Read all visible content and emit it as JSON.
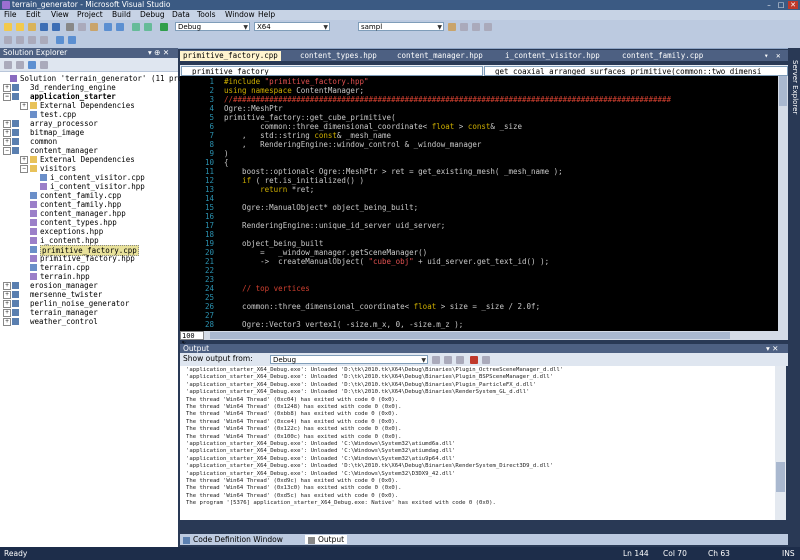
{
  "window": {
    "title": "terrain_generator - Microsoft Visual Studio",
    "min": "–",
    "max": "□",
    "close": "✕"
  },
  "menu": [
    "File",
    "Edit",
    "View",
    "Project",
    "Build",
    "Debug",
    "Data",
    "Tools",
    "Window",
    "Help"
  ],
  "toolbar": {
    "config": "Debug",
    "platform": "X64",
    "find": "sampl"
  },
  "solution_explorer": {
    "title": "Solution Explorer",
    "pin": "▾ ⊕ ✕",
    "items": [
      {
        "label": "Solution 'terrain_generator' (11 proj",
        "icon": "solution-icon"
      },
      {
        "label": "3d_rendering_engine",
        "icon": "project-icon"
      },
      {
        "label": "application_starter",
        "icon": "project-icon"
      },
      {
        "label": "External Dependencies",
        "icon": "folder-icon"
      },
      {
        "label": "test.cpp",
        "icon": "cpp-file-icon"
      },
      {
        "label": "array_processor",
        "icon": "project-icon"
      },
      {
        "label": "bitmap_image",
        "icon": "project-icon"
      },
      {
        "label": "common",
        "icon": "project-icon"
      },
      {
        "label": "content_manager",
        "icon": "project-icon"
      },
      {
        "label": "External Dependencies",
        "icon": "folder-icon"
      },
      {
        "label": "visitors",
        "icon": "folder-icon"
      },
      {
        "label": "i_content_visitor.cpp",
        "icon": "cpp-file-icon"
      },
      {
        "label": "i_content_visitor.hpp",
        "icon": "hpp-file-icon"
      },
      {
        "label": "content_family.cpp",
        "icon": "cpp-file-icon"
      },
      {
        "label": "content_family.hpp",
        "icon": "hpp-file-icon"
      },
      {
        "label": "content_manager.hpp",
        "icon": "hpp-file-icon"
      },
      {
        "label": "content_types.hpp",
        "icon": "hpp-file-icon"
      },
      {
        "label": "exceptions.hpp",
        "icon": "hpp-file-icon"
      },
      {
        "label": "i_content.hpp",
        "icon": "hpp-file-icon"
      },
      {
        "label": "primitive_factory.cpp",
        "icon": "cpp-file-icon"
      },
      {
        "label": "primitive_factory.hpp",
        "icon": "hpp-file-icon"
      },
      {
        "label": "terrain.cpp",
        "icon": "cpp-file-icon"
      },
      {
        "label": "terrain.hpp",
        "icon": "hpp-file-icon"
      },
      {
        "label": "erosion_manager",
        "icon": "project-icon"
      },
      {
        "label": "mersenne_twister",
        "icon": "project-icon"
      },
      {
        "label": "perlin_noise_generator",
        "icon": "project-icon"
      },
      {
        "label": "terrain_manager",
        "icon": "project-icon"
      },
      {
        "label": "weather_control",
        "icon": "project-icon"
      }
    ]
  },
  "tabs": [
    "primitive_factory.cpp",
    "content_types.hpp",
    "content_manager.hpp",
    "i_content_visitor.hpp",
    "content_family.cpp"
  ],
  "navbar": {
    "left": "primitive_factory",
    "right": "get_coaxial_arranged_surfaces_primitive(common::two_dimensi"
  },
  "code_lines": [
    {
      "n": "1",
      "html": "<span class='kw'>#include</span> <span class='st'>\"primitive_factory.hpp\"</span>"
    },
    {
      "n": "2",
      "html": "<span class='kw'>using namespace</span> ContentManager;"
    },
    {
      "n": "3",
      "html": "<span class='cm'>//#################################################################################################</span>"
    },
    {
      "n": "4",
      "html": "Ogre::MeshPtr"
    },
    {
      "n": "5",
      "html": "primitive_factory::get_cube_primitive("
    },
    {
      "n": "6",
      "html": "        common::three_dimensional_coordinate&lt; <span class='kw'>float</span> &gt; <span class='kw'>const</span>&amp; _size"
    },
    {
      "n": "7",
      "html": "    ,   std::string <span class='kw'>const</span>&amp; _mesh_name"
    },
    {
      "n": "8",
      "html": "    ,   RenderingEngine::window_control &amp; _window_manager"
    },
    {
      "n": "9",
      "html": ")"
    },
    {
      "n": "10",
      "html": "{"
    },
    {
      "n": "11",
      "html": "    boost::optional&lt; Ogre::MeshPtr &gt; ret = get_existing_mesh( _mesh_name );"
    },
    {
      "n": "12",
      "html": "    <span class='kw'>if</span> ( ret.is_initialized() )"
    },
    {
      "n": "13",
      "html": "        <span class='kw'>return</span> *ret;"
    },
    {
      "n": "14",
      "html": ""
    },
    {
      "n": "15",
      "html": "    Ogre::ManualObject* object_being_built;"
    },
    {
      "n": "16",
      "html": ""
    },
    {
      "n": "17",
      "html": "    RenderingEngine::unique_id_server uid_server;"
    },
    {
      "n": "18",
      "html": ""
    },
    {
      "n": "19",
      "html": "    object_being_built"
    },
    {
      "n": "20",
      "html": "        =   _window_manager.getSceneManager()"
    },
    {
      "n": "21",
      "html": "        -&gt;  createManualObject( <span class='st'>\"cube_obj\"</span> + uid_server.get_text_id() );"
    },
    {
      "n": "22",
      "html": ""
    },
    {
      "n": "23",
      "html": ""
    },
    {
      "n": "24",
      "html": "    <span class='cm'>// top vertices</span>"
    },
    {
      "n": "25",
      "html": ""
    },
    {
      "n": "26",
      "html": "    common::three_dimensional_coordinate&lt; <span class='kw'>float</span> &gt; size = _size / 2.0f;"
    },
    {
      "n": "27",
      "html": ""
    },
    {
      "n": "28",
      "html": "    Ogre::Vector3 vertex1( -size.m_x, 0, -size.m_z );"
    }
  ],
  "zoom": "100 %",
  "output": {
    "title": "Output",
    "show_label": "Show output from:",
    "source": "Debug",
    "lines": [
      "'application_starter_X64_Debug.exe': Unloaded 'D:\\tk\\2010.tk\\X64\\Debug\\Binaries\\Plugin_OctreeSceneManager_d.dll'",
      "'application_starter_X64_Debug.exe': Unloaded 'D:\\tk\\2010.tk\\X64\\Debug\\Binaries\\Plugin_BSPSceneManager_d.dll'",
      "'application_starter_X64_Debug.exe': Unloaded 'D:\\tk\\2010.tk\\X64\\Debug\\Binaries\\Plugin_ParticleFX_d.dll'",
      "'application_starter_X64_Debug.exe': Unloaded 'D:\\tk\\2010.tk\\X64\\Debug\\Binaries\\RenderSystem_GL_d.dll'",
      "The thread 'Win64 Thread' (0xc04) has exited with code 0 (0x0).",
      "The thread 'Win64 Thread' (0x1248) has exited with code 0 (0x0).",
      "The thread 'Win64 Thread' (0xbb8) has exited with code 0 (0x0).",
      "The thread 'Win64 Thread' (0xce4) has exited with code 0 (0x0).",
      "The thread 'Win64 Thread' (0x122c) has exited with code 0 (0x0).",
      "The thread 'Win64 Thread' (0x100c) has exited with code 0 (0x0).",
      "'application_starter_X64_Debug.exe': Unloaded 'C:\\Windows\\System32\\atiumd6a.dll'",
      "'application_starter_X64_Debug.exe': Unloaded 'C:\\Windows\\System32\\atiumdag.dll'",
      "'application_starter_X64_Debug.exe': Unloaded 'C:\\Windows\\System32\\atiu9p64.dll'",
      "'application_starter_X64_Debug.exe': Unloaded 'D:\\tk\\2010.tk\\X64\\Debug\\Binaries\\RenderSystem_Direct3D9_d.dll'",
      "'application_starter_X64_Debug.exe': Unloaded 'C:\\Windows\\System32\\D3DX9_42.dll'",
      "The thread 'Win64 Thread' (0xd9c) has exited with code 0 (0x0).",
      "The thread 'Win64 Thread' (0x13c0) has exited with code 0 (0x0).",
      "The thread 'Win64 Thread' (0xd5c) has exited with code 0 (0x0).",
      "The program '[5376] application_starter_X64_Debug.exe: Native' has exited with code 0 (0x0)."
    ]
  },
  "bottom_tabs": [
    "Code Definition Window",
    "Output"
  ],
  "right_strip": "Server Explorer",
  "status": {
    "left": "Ready",
    "ln": "Ln 144",
    "col": "Col 70",
    "ch": "Ch 63",
    "ins": "INS"
  },
  "colors": {
    "accent": "#3b5a83",
    "editor_bg": "#000000"
  }
}
